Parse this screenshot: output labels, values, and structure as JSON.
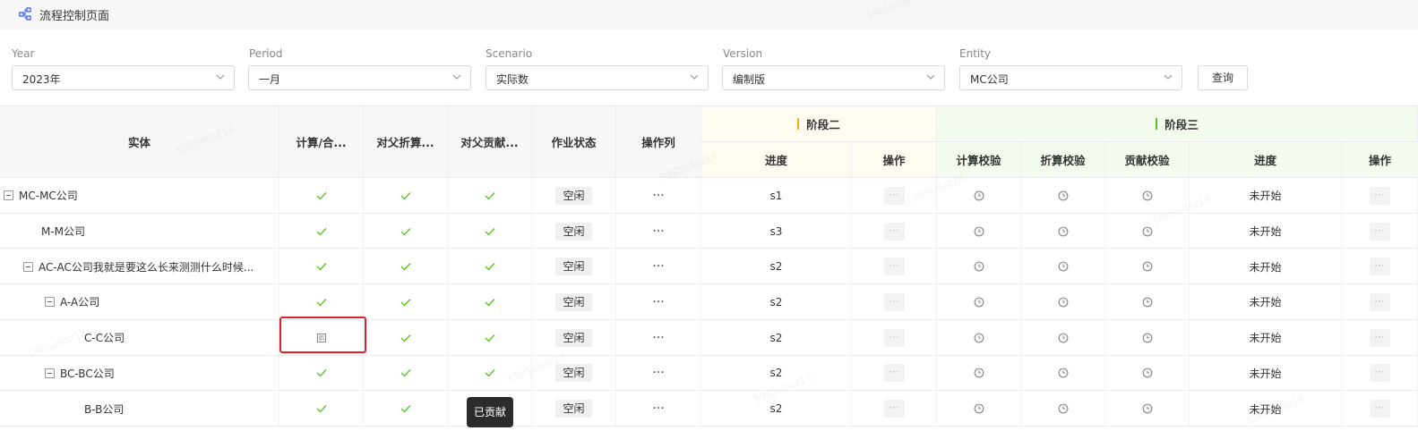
{
  "page": {
    "title": "流程控制页面"
  },
  "filters": {
    "year": {
      "label": "Year",
      "value": "2023年"
    },
    "period": {
      "label": "Period",
      "value": "一月"
    },
    "scenario": {
      "label": "Scenario",
      "value": "实际数"
    },
    "version": {
      "label": "Version",
      "value": "编制版"
    },
    "entity": {
      "label": "Entity",
      "value": "MC公司"
    },
    "query_button": "查询"
  },
  "table": {
    "headers": {
      "entity": "实体",
      "calc": "计算/合...",
      "translate": "对父折算...",
      "contribute": "对父贡献...",
      "job_status": "作业状态",
      "op_col": "操作列",
      "stage2": "阶段二",
      "stage2_progress": "进度",
      "stage2_op": "操作",
      "stage3": "阶段三",
      "calc_check": "计算校验",
      "translate_check": "折算校验",
      "contribute_check": "贡献校验",
      "stage3_progress": "进度",
      "stage3_op": "操作"
    },
    "rows": [
      {
        "entity": "MC-MC公司",
        "job_status": "空闲",
        "stage2_progress": "s1",
        "stage3_progress": "未开始"
      },
      {
        "entity": "M-M公司",
        "job_status": "空闲",
        "stage2_progress": "s3",
        "stage3_progress": "未开始"
      },
      {
        "entity": "AC-AC公司我就是要这么长来测测什么时候...",
        "job_status": "空闲",
        "stage2_progress": "s2",
        "stage3_progress": "未开始"
      },
      {
        "entity": "A-A公司",
        "job_status": "空闲",
        "stage2_progress": "s2",
        "stage3_progress": "未开始"
      },
      {
        "entity": "C-C公司",
        "job_status": "空闲",
        "stage2_progress": "s2",
        "stage3_progress": "未开始"
      },
      {
        "entity": "BC-BC公司",
        "job_status": "空闲",
        "stage2_progress": "s2",
        "stage3_progress": "未开始"
      },
      {
        "entity": "B-B公司",
        "job_status": "空闲",
        "stage2_progress": "s2",
        "stage3_progress": "未开始"
      }
    ],
    "dots": "···"
  },
  "tooltip": "已贡献",
  "watermark": "5985e0az1X",
  "colors": {
    "check": "#52c41a",
    "stage2_bg": "#fffbf0",
    "stage2_bar": "#faad14",
    "stage3_bg": "#f3fcee",
    "stage3_bar": "#52c41a",
    "highlight": "#e0202a"
  },
  "icons": {
    "title": "flow-control-icon",
    "select": "chevron-down-icon",
    "done": "check-icon",
    "pending": "clock-icon",
    "highlighted_calc": "document-icon"
  }
}
